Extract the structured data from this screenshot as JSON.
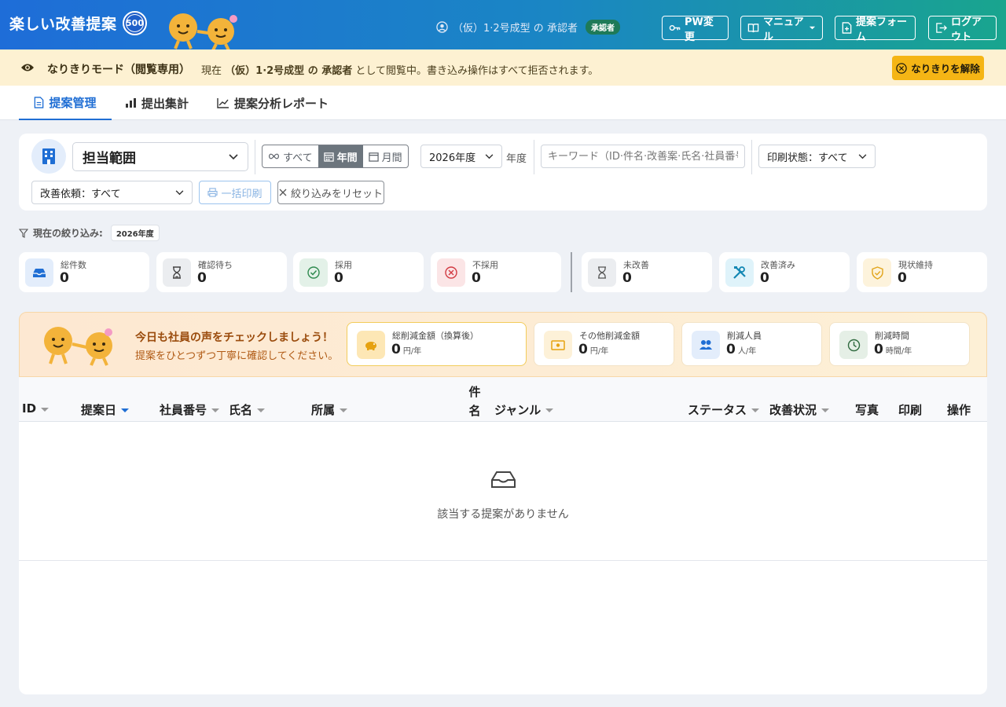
{
  "header": {
    "app_title": "楽しい改善提案",
    "badge": "500",
    "user_name": "（仮）1·2号成型 の 承認者",
    "role_chip": "承認者",
    "buttons": {
      "pw_change": "PW変更",
      "manual": "マニュアル",
      "proposal_form": "提案フォーム",
      "logout": "ログアウト"
    }
  },
  "impersonation": {
    "title": "なりきりモード（閲覧専用）",
    "msg_prefix": "現在",
    "msg_target": "（仮）1·2号成型 の 承認者",
    "msg_suffix": "として閲覧中。書き込み操作はすべて拒否されます。",
    "release_button": "なりきりを解除"
  },
  "tabs": [
    {
      "label": "提案管理"
    },
    {
      "label": "提出集計"
    },
    {
      "label": "提案分析レポート"
    }
  ],
  "filters": {
    "scope_label": "担当範囲",
    "period": {
      "all": "すべて",
      "year": "年間",
      "month": "月間"
    },
    "fiscal_year": "2026年度",
    "fiscal_suffix": "年度",
    "keyword_placeholder": "キーワード（ID·件名·改善案·氏名·社員番号）",
    "print_state": "印刷状態：すべて",
    "request": "改善依頼：すべて",
    "bulk_print": "一括印刷",
    "reset": "絞り込みをリセット"
  },
  "current_filter": {
    "label": "現在の絞り込み:",
    "chip": "2026年度"
  },
  "stats": [
    {
      "label": "総件数",
      "value": "0",
      "icon": "inbox-icon"
    },
    {
      "label": "確認待ち",
      "value": "0",
      "icon": "hourglass-icon"
    },
    {
      "label": "採用",
      "value": "0",
      "icon": "check-circle-icon"
    },
    {
      "label": "不採用",
      "value": "0",
      "icon": "x-circle-icon"
    },
    {
      "label": "未改善",
      "value": "0",
      "icon": "hourglass-icon"
    },
    {
      "label": "改善済み",
      "value": "0",
      "icon": "tools-icon"
    },
    {
      "label": "現状維持",
      "value": "0",
      "icon": "shield-icon"
    }
  ],
  "banner": {
    "title": "今日も社員の声をチェックしましょう！",
    "subtitle": "提案をひとつずつ丁寧に確認してください。"
  },
  "metrics": [
    {
      "label": "総削減金額（換算後）",
      "value": "0",
      "unit": "円/年"
    },
    {
      "label": "その他削減金額",
      "value": "0",
      "unit": "円/年"
    },
    {
      "label": "削減人員",
      "value": "0",
      "unit": "人/年"
    },
    {
      "label": "削減時間",
      "value": "0",
      "unit": "時間/年"
    }
  ],
  "table": {
    "columns": {
      "id": "ID",
      "date": "提案日",
      "emp_no": "社員番号",
      "name": "氏名",
      "dept": "所属",
      "subject_1": "件",
      "subject_2": "名",
      "genre": "ジャンル",
      "status": "ステータス",
      "improve": "改善状況",
      "photo": "写真",
      "print": "印刷",
      "action": "操作"
    },
    "empty_message": "該当する提案がありません"
  },
  "colors": {
    "header_start": "#1e6dd8",
    "header_end": "#19a58e",
    "accent": "#1f6ed4",
    "warn_banner": "#fdf1d2",
    "release_btn": "#f5b515"
  }
}
